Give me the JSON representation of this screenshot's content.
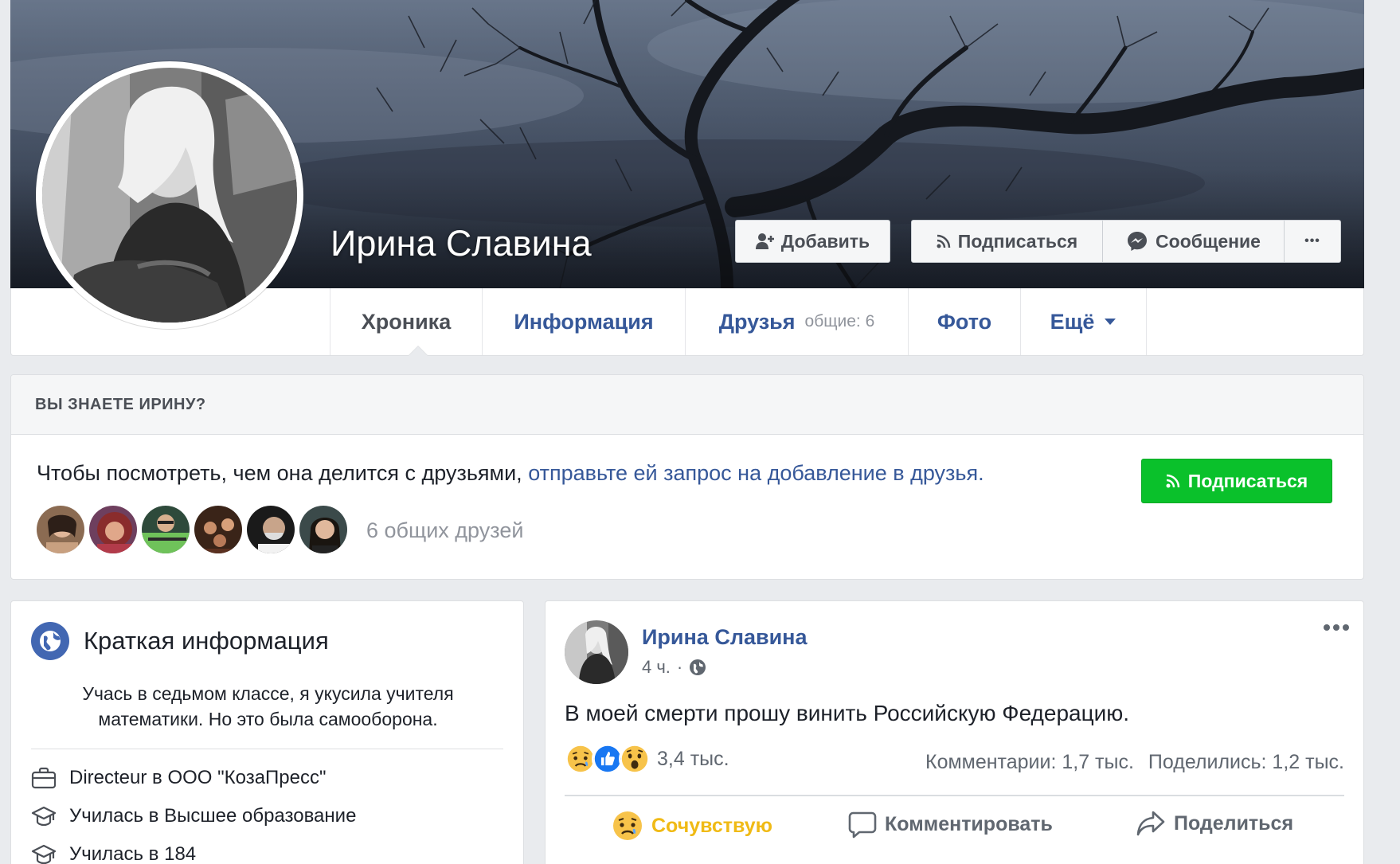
{
  "profile": {
    "name": "Ирина Славина"
  },
  "cover_buttons": {
    "add": "Добавить",
    "follow": "Подписаться",
    "message": "Сообщение",
    "more": "•••"
  },
  "tabs": [
    {
      "label": "Хроника"
    },
    {
      "label": "Информация"
    },
    {
      "label": "Друзья",
      "sub": "общие: 6"
    },
    {
      "label": "Фото"
    },
    {
      "label": "Ещё"
    }
  ],
  "know_card": {
    "header": "ВЫ ЗНАЕТЕ ИРИНУ?",
    "text": "Чтобы посмотреть, чем она делится с друзьями,",
    "link": "отправьте ей запрос на добавление в друзья.",
    "follow_button": "Подписаться",
    "mutual_friends": "6 общих друзей"
  },
  "intro": {
    "title": "Краткая информация",
    "bio": "Учась в седьмом классе, я укусила учителя математики. Но это была самооборона.",
    "rows": [
      {
        "icon": "briefcase-icon",
        "text": "Directeur в ООО \"КозаПресс\""
      },
      {
        "icon": "graduation-cap-icon",
        "text": "Училась в Высшее образование"
      },
      {
        "icon": "graduation-cap-icon",
        "text": "Училась в 184"
      }
    ]
  },
  "post": {
    "author": "Ирина Славина",
    "time": "4 ч.",
    "separator": "·",
    "text": "В моей смерти прошу винить Российскую Федерацию.",
    "reactions_count": "3,4 тыс.",
    "comments": "Комментарии: 1,7 тыс.",
    "shares": "Поделились: 1,2 тыс.",
    "actions": {
      "sympathize": "Сочувствую",
      "comment": "Комментировать",
      "share": "Поделиться"
    }
  },
  "colors": {
    "link": "#365899",
    "green": "#0ac12b",
    "background": "#e9ebee",
    "sympathize": "#f0ba15"
  }
}
